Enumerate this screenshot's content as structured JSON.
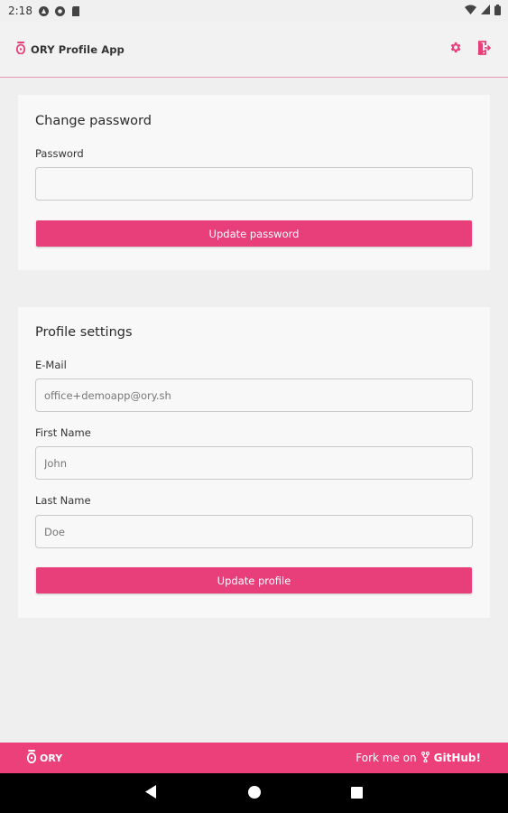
{
  "status_bar": {
    "time": "2:18"
  },
  "header": {
    "title": "ORY Profile App",
    "accent_color": "#e83e7a",
    "icons": [
      "ory-logo-icon",
      "gear-icon",
      "logout-icon"
    ]
  },
  "password_card": {
    "title": "Change password",
    "password_label": "Password",
    "password_value": "",
    "button_label": "Update password"
  },
  "profile_card": {
    "title": "Profile settings",
    "email_label": "E-Mail",
    "email_value": "office+demoapp@ory.sh",
    "first_name_label": "First Name",
    "first_name_value": "John",
    "last_name_label": "Last Name",
    "last_name_value": "Doe",
    "button_label": "Update profile"
  },
  "footer": {
    "logo_text": "ORY",
    "fork_text": "Fork me on",
    "github_text": "GitHub!",
    "background_color": "#ec407a"
  }
}
